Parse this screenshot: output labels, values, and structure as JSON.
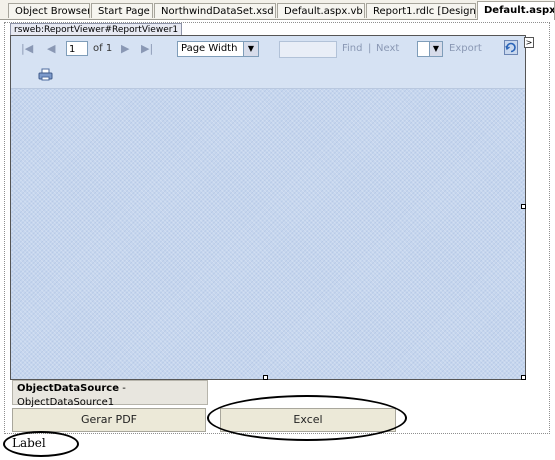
{
  "tabs": [
    {
      "label": "Object Browser"
    },
    {
      "label": "Start Page"
    },
    {
      "label": "NorthwindDataSet.xsd"
    },
    {
      "label": "Default.aspx.vb"
    },
    {
      "label": "Report1.rdlc [Design]"
    },
    {
      "label": "Default.aspx*",
      "active": true
    }
  ],
  "report_viewer": {
    "tag": "rsweb:ReportViewer#ReportViewer1",
    "toolbar": {
      "first_icon": "|◀",
      "prev_icon": "◀",
      "page_value": "1",
      "of_pages": "of 1",
      "next_icon": "▶",
      "last_icon": "▶|",
      "zoom_value": "Page Width",
      "find_label": "Find",
      "separator": "|",
      "next_label": "Next",
      "export_label": "Export"
    }
  },
  "object_data_source": {
    "type": "ObjectDataSource",
    "name": "- ObjectDataSource1"
  },
  "buttons": {
    "pdf_label": "Gerar PDF",
    "excel_label": "Excel"
  },
  "label_text": "Label"
}
